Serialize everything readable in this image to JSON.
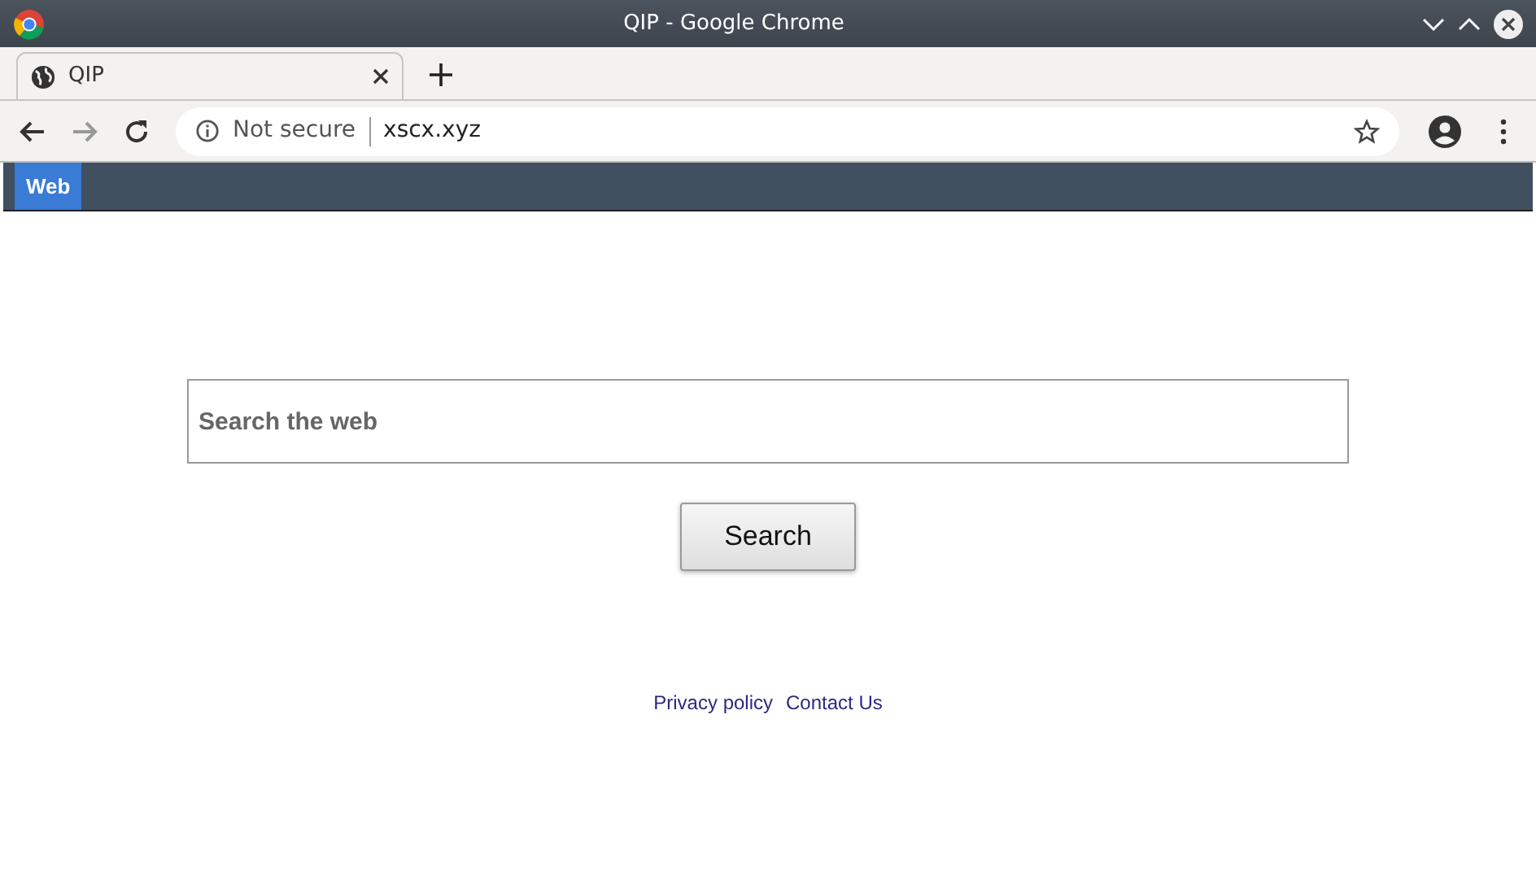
{
  "window": {
    "title": "QIP - Google Chrome"
  },
  "tabs": [
    {
      "title": "QIP",
      "selected": true
    }
  ],
  "nav_buttons": [
    {
      "kind": "back",
      "disabled": false
    },
    {
      "kind": "forward",
      "disabled": true
    },
    {
      "kind": "reload",
      "disabled": false
    }
  ],
  "address_bar": {
    "security": "Not secure",
    "url": "xscx.xyz"
  },
  "site_nav": [
    {
      "label": "Web",
      "selected": true
    }
  ],
  "search": {
    "placeholder": "Search the web",
    "button": "Search"
  },
  "footer_links": [
    "Privacy policy",
    "Contact Us"
  ]
}
